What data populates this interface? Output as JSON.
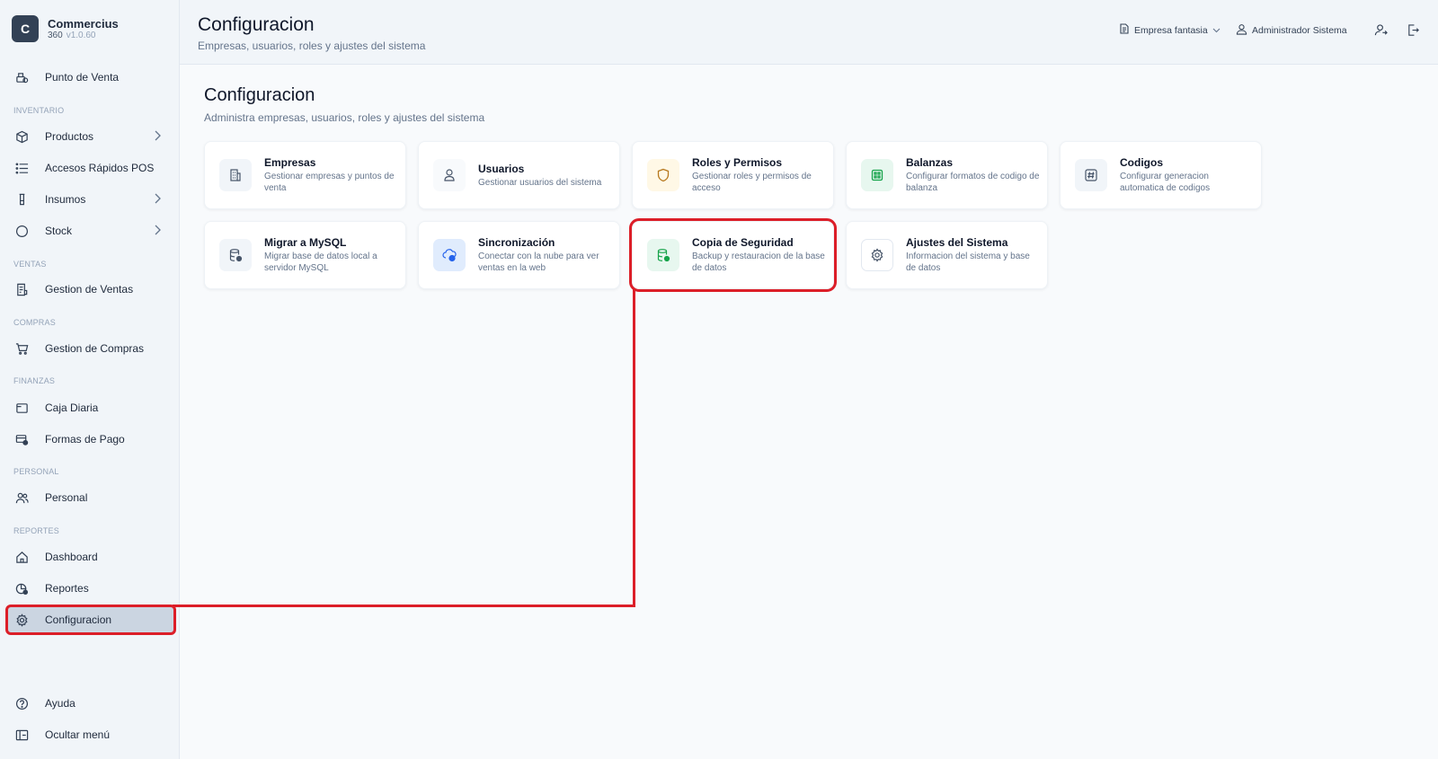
{
  "brand": {
    "logo_letter": "C",
    "name": "Commercius",
    "sub": "360",
    "version": "v1.0.60"
  },
  "sidebar": {
    "items": {
      "pos": {
        "label": "Punto de Venta",
        "icon": "cash-register-icon"
      },
      "productos": {
        "label": "Productos",
        "icon": "box-icon"
      },
      "accesos": {
        "label": "Accesos Rápidos POS",
        "icon": "list-icon"
      },
      "insumos": {
        "label": "Insumos",
        "icon": "flask-icon"
      },
      "stock": {
        "label": "Stock",
        "icon": "circle-icon"
      },
      "ventas": {
        "label": "Gestion de Ventas",
        "icon": "receipt-icon"
      },
      "compras": {
        "label": "Gestion de Compras",
        "icon": "cart-icon"
      },
      "caja": {
        "label": "Caja Diaria",
        "icon": "wallet-icon"
      },
      "formas": {
        "label": "Formas de Pago",
        "icon": "credit-card-icon"
      },
      "personal": {
        "label": "Personal",
        "icon": "users-icon"
      },
      "dashboard": {
        "label": "Dashboard",
        "icon": "home-icon"
      },
      "reportes": {
        "label": "Reportes",
        "icon": "chart-icon"
      },
      "configuracion": {
        "label": "Configuracion",
        "icon": "gear-icon"
      },
      "ayuda": {
        "label": "Ayuda",
        "icon": "help-icon"
      },
      "ocultar": {
        "label": "Ocultar menú",
        "icon": "sidebar-icon"
      }
    },
    "sections": {
      "inventario": "INVENTARIO",
      "ventas": "VENTAS",
      "compras": "COMPRAS",
      "finanzas": "FINANZAS",
      "personal": "PERSONAL",
      "reportes": "REPORTES"
    }
  },
  "header": {
    "title": "Configuracion",
    "subtitle": "Empresas, usuarios, roles y ajustes del sistema",
    "company": "Empresa fantasia",
    "user": "Administrador Sistema"
  },
  "main": {
    "title": "Configuracion",
    "subtitle": "Administra empresas, usuarios, roles y ajustes del sistema",
    "cards": [
      {
        "title": "Empresas",
        "desc": "Gestionar empresas y puntos de venta",
        "icon": "building-icon",
        "color": "#f1f5f9"
      },
      {
        "title": "Usuarios",
        "desc": "Gestionar usuarios del sistema",
        "icon": "user-icon",
        "color": "#f8fafc"
      },
      {
        "title": "Roles y Permisos",
        "desc": "Gestionar roles y permisos de acceso",
        "icon": "shield-icon",
        "color": "#fff8e6"
      },
      {
        "title": "Balanzas",
        "desc": "Configurar formatos de codigo de balanza",
        "icon": "scale-icon",
        "color": "#e7f7ef"
      },
      {
        "title": "Codigos",
        "desc": "Configurar generacion automatica de codigos",
        "icon": "hash-icon",
        "color": "#f1f5f9"
      },
      {
        "title": "Migrar a MySQL",
        "desc": "Migrar base de datos local a servidor MySQL",
        "icon": "database-icon",
        "color": "#f1f5f9"
      },
      {
        "title": "Sincronización",
        "desc": "Conectar con la nube para ver ventas en la web",
        "icon": "cloud-sync-icon",
        "color": "#e0ecfd"
      },
      {
        "title": "Copia de Seguridad",
        "desc": "Backup y restauracion de la base de datos",
        "icon": "backup-icon",
        "color": "#e7f7ef"
      },
      {
        "title": "Ajustes del Sistema",
        "desc": "Informacion del sistema y base de datos",
        "icon": "gear-icon",
        "color": "#ffffff"
      }
    ]
  },
  "colors": {
    "highlight": "#dc1e28",
    "sidebar_bg": "#f1f5f9",
    "active_bg": "#cbd5e1"
  }
}
